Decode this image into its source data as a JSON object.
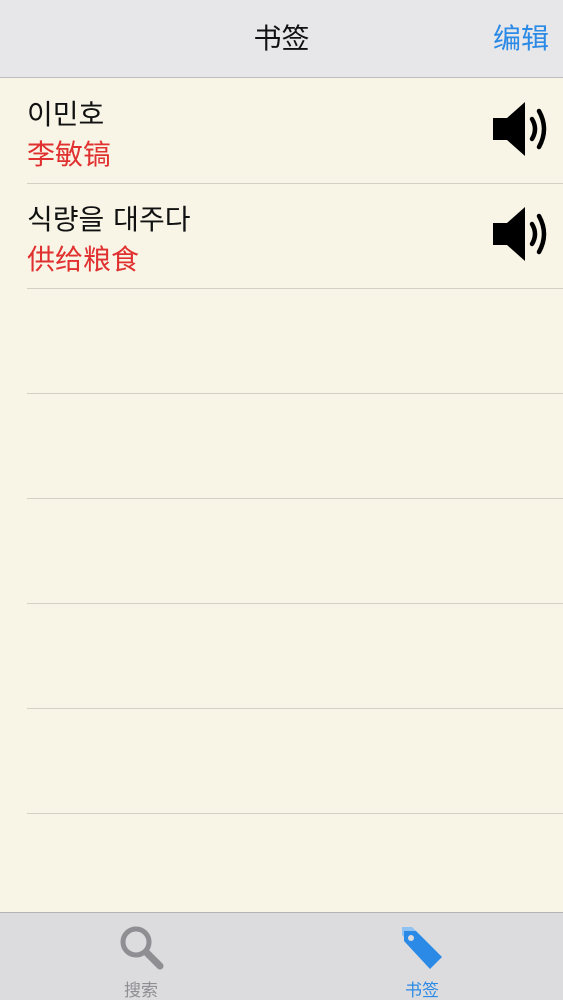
{
  "nav": {
    "title": "书签",
    "edit_label": "编辑"
  },
  "bookmarks": [
    {
      "word": "이민호",
      "meaning": "李敏镐",
      "speaker_icon": "speaker-icon"
    },
    {
      "word": "식량을 대주다",
      "meaning": "供给粮食",
      "speaker_icon": "speaker-icon"
    }
  ],
  "tabs": [
    {
      "label": "搜索",
      "icon": "search-icon",
      "selected": false
    },
    {
      "label": "书签",
      "icon": "tag-icon",
      "selected": true
    }
  ],
  "colors": {
    "accent": "#2a8ae6",
    "meaning_text": "#e03030",
    "list_background": "#f8f5e6",
    "nav_background": "#e7e6e9",
    "tab_inactive": "#8e8e93"
  }
}
